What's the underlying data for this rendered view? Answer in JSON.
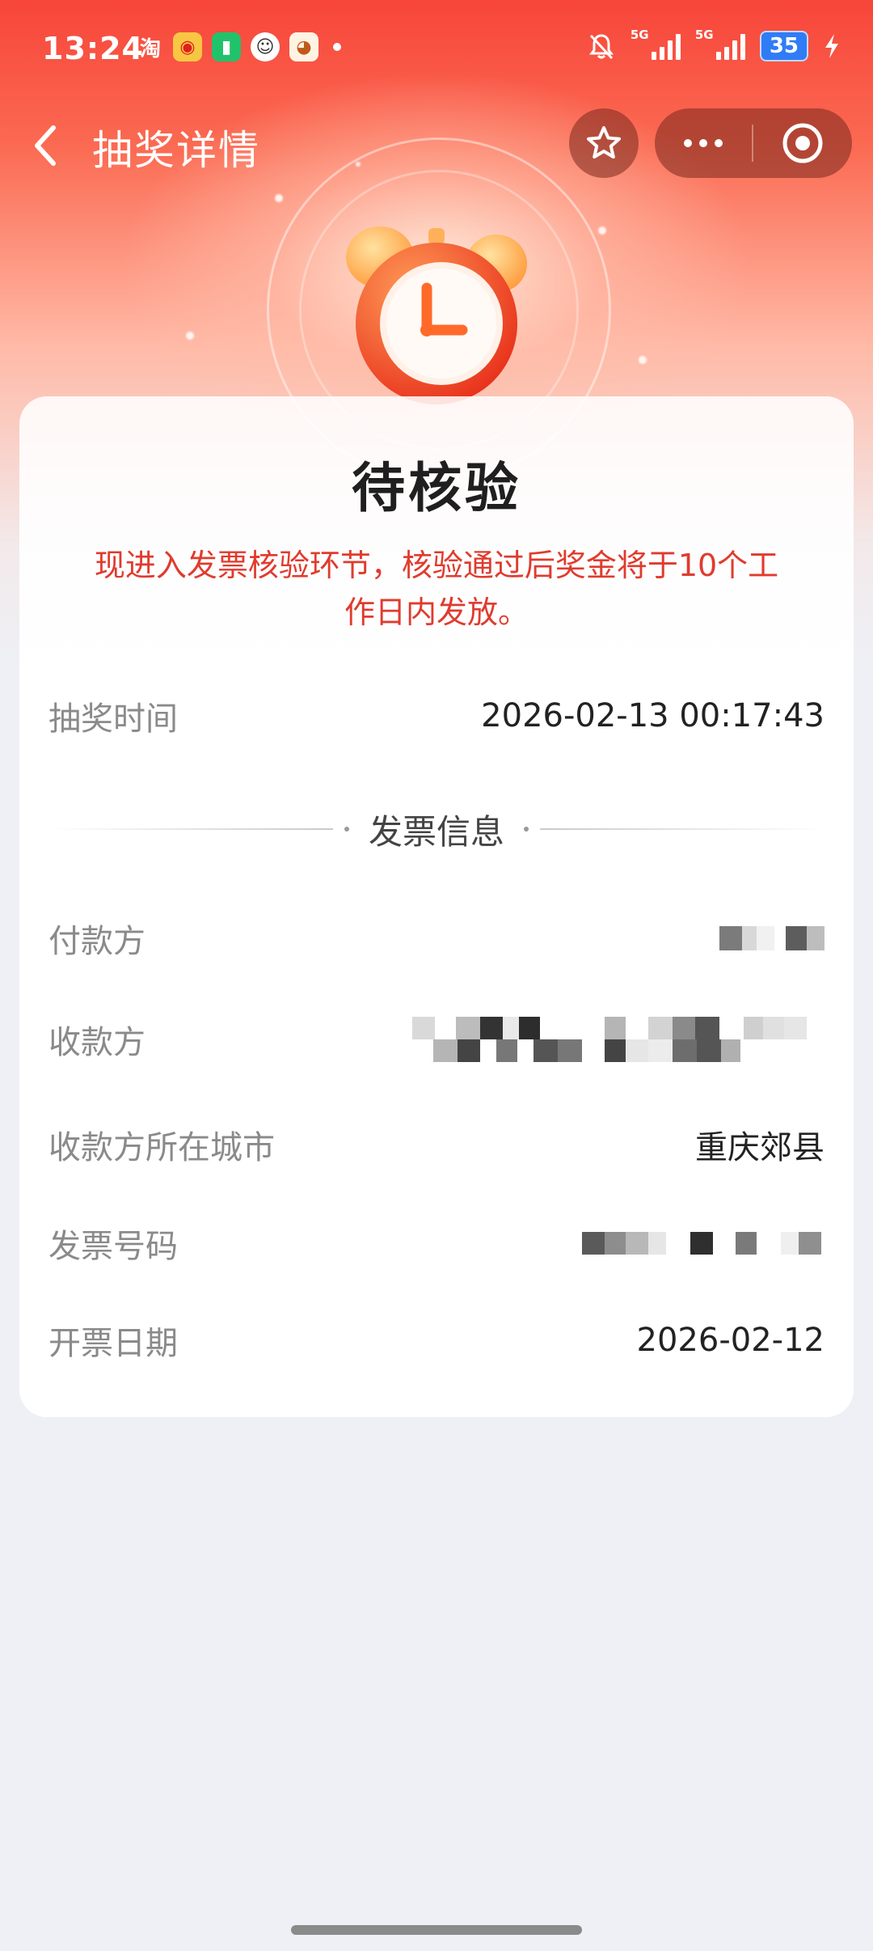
{
  "status_bar": {
    "time": "13:24",
    "taobao_glyph": "淘",
    "battery": "35",
    "signal1_label": "5G",
    "signal2_label": "5G"
  },
  "nav": {
    "title": "抽奖详情"
  },
  "card": {
    "status_title": "待核验",
    "notice": "现进入发票核验环节，核验通过后奖金将于10个工作日内发放。",
    "draw_time_label": "抽奖时间",
    "draw_time_value": "2026-02-13 00:17:43",
    "section_title": "发票信息",
    "payer_label": "付款方",
    "payee_label": "收款方",
    "payee_city_label": "收款方所在城市",
    "payee_city_value": "重庆郊县",
    "invoice_no_label": "发票号码",
    "invoice_date_label": "开票日期",
    "invoice_date_value": "2026-02-12"
  },
  "colors": {
    "header_red": "#f7453a",
    "notice_red": "#e03b2e",
    "battery_blue": "#2f7cf6"
  }
}
